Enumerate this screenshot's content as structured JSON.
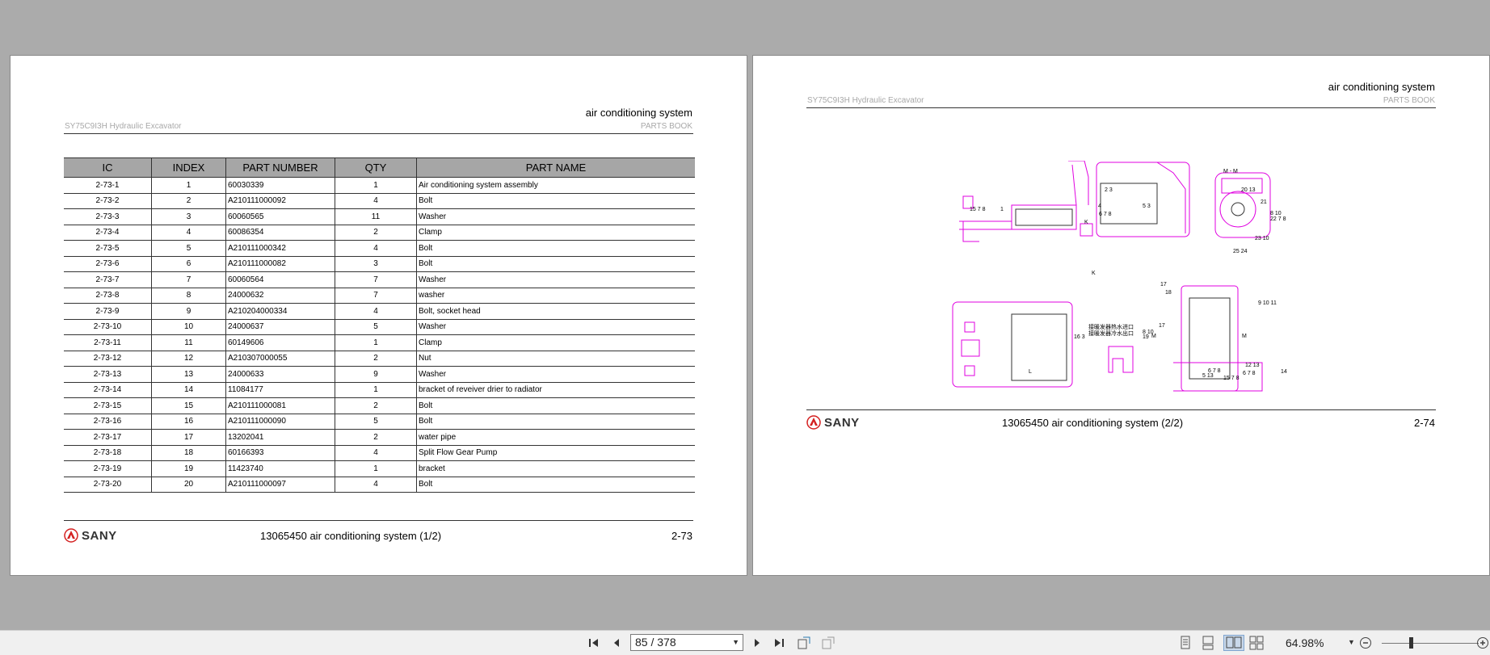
{
  "viewer": {
    "page_indicator": "85 / 378",
    "zoom": "64.98%",
    "zoom_slider_level": 0.28,
    "icons": [
      "first-page-icon",
      "prev-page-icon",
      "next-page-icon",
      "last-page-icon",
      "previous-view-icon",
      "next-view-icon",
      "single-page-view-icon",
      "continuous-view-icon",
      "two-page-view-icon",
      "two-page-continuous-view-icon",
      "zoom-out-icon",
      "zoom-in-icon"
    ]
  },
  "left_page": {
    "header_title": "air conditioning system",
    "model": "SY75C9I3H Hydraulic Excavator",
    "book": "PARTS BOOK",
    "table": {
      "headers": [
        "IC",
        "INDEX",
        "PART NUMBER",
        "QTY",
        "PART NAME"
      ],
      "rows": [
        [
          "2-73-1",
          "1",
          "60030339",
          "1",
          "Air conditioning system assembly"
        ],
        [
          "2-73-2",
          "2",
          "A210111000092",
          "4",
          "Bolt"
        ],
        [
          "2-73-3",
          "3",
          "60060565",
          "11",
          "Washer"
        ],
        [
          "2-73-4",
          "4",
          "60086354",
          "2",
          "Clamp"
        ],
        [
          "2-73-5",
          "5",
          "A210111000342",
          "4",
          "Bolt"
        ],
        [
          "2-73-6",
          "6",
          "A210111000082",
          "3",
          "Bolt"
        ],
        [
          "2-73-7",
          "7",
          "60060564",
          "7",
          "Washer"
        ],
        [
          "2-73-8",
          "8",
          "24000632",
          "7",
          "washer"
        ],
        [
          "2-73-9",
          "9",
          "A210204000334",
          "4",
          "Bolt, socket head"
        ],
        [
          "2-73-10",
          "10",
          "24000637",
          "5",
          "Washer"
        ],
        [
          "2-73-11",
          "11",
          "60149606",
          "1",
          "Clamp"
        ],
        [
          "2-73-12",
          "12",
          "A210307000055",
          "2",
          "Nut"
        ],
        [
          "2-73-13",
          "13",
          "24000633",
          "9",
          "Washer"
        ],
        [
          "2-73-14",
          "14",
          "11084177",
          "1",
          "bracket of reveiver drier to radiator"
        ],
        [
          "2-73-15",
          "15",
          "A210111000081",
          "2",
          "Bolt"
        ],
        [
          "2-73-16",
          "16",
          "A210111000090",
          "5",
          "Bolt"
        ],
        [
          "2-73-17",
          "17",
          "13202041",
          "2",
          "water pipe"
        ],
        [
          "2-73-18",
          "18",
          "60166393",
          "4",
          "Split Flow Gear Pump"
        ],
        [
          "2-73-19",
          "19",
          "11423740",
          "1",
          "bracket"
        ],
        [
          "2-73-20",
          "20",
          "A210111000097",
          "4",
          "Bolt"
        ]
      ]
    },
    "logo": "SANY",
    "caption": "13065450 air conditioning system (1/2)",
    "page_number": "2-73"
  },
  "right_page": {
    "header_title": "air conditioning system",
    "model": "SY75C9I3H Hydraulic Excavator",
    "book": "PARTS BOOK",
    "logo": "SANY",
    "caption": "13065450 air conditioning system (2/2)",
    "page_number": "2-74",
    "drawing_labels": [
      "15 7 8",
      "1",
      "2 3",
      "4",
      "5 3",
      "6 7 8",
      "K",
      "M - M",
      "20 13",
      "21",
      "8 10",
      "22 7 8",
      "23 10",
      "25 24",
      "K",
      "17",
      "18",
      "17",
      "M",
      "M",
      "9 10 11",
      "8 10",
      "19",
      "16 3",
      "L",
      "12 13",
      "6 7 8",
      "5 13",
      "6 7 8",
      "15 7 8",
      "14"
    ],
    "chinese_labels": [
      "接暖发器热水进口",
      "接暖发器冷水出口"
    ]
  },
  "colors": {
    "drawing": "#e000e0",
    "table_header": "#a6a6a6",
    "logo_red": "#d42020"
  }
}
